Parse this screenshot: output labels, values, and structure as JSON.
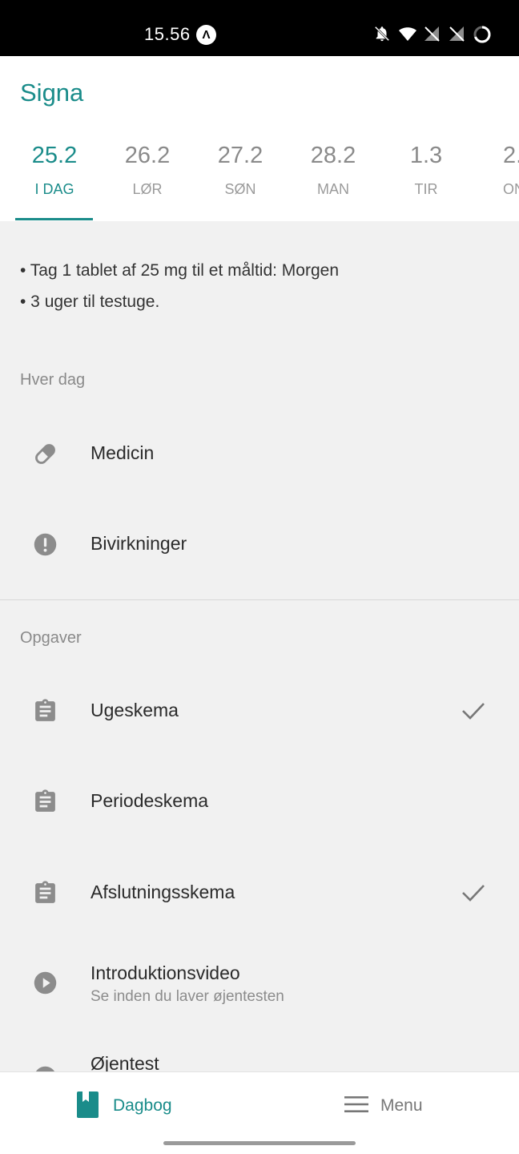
{
  "status_bar": {
    "time": "15.56",
    "icons": [
      "app-notification-icon",
      "bell-off-icon",
      "wifi-icon",
      "signal-no-sim-icon",
      "signal-no-sim-icon",
      "battery-ring-icon"
    ]
  },
  "app": {
    "title": "Signa",
    "accent_color": "#1a8c8a"
  },
  "tabs": [
    {
      "date": "25.2",
      "day": "I DAG",
      "active": true
    },
    {
      "date": "26.2",
      "day": "LØR"
    },
    {
      "date": "27.2",
      "day": "SØN"
    },
    {
      "date": "28.2",
      "day": "MAN"
    },
    {
      "date": "1.3",
      "day": "TIR"
    },
    {
      "date": "2.",
      "day": "ON"
    }
  ],
  "info": {
    "lines": [
      "• Tag 1 tablet af 25 mg til et måltid: Morgen",
      "• 3 uger til testuge."
    ]
  },
  "daily": {
    "heading": "Hver dag",
    "items": [
      {
        "label": "Medicin",
        "icon": "pill-icon"
      },
      {
        "label": "Bivirkninger",
        "icon": "alert-circle-icon"
      }
    ]
  },
  "tasks": {
    "heading": "Opgaver",
    "items": [
      {
        "label": "Ugeskema",
        "icon": "clipboard-icon",
        "done": true
      },
      {
        "label": "Periodeskema",
        "icon": "clipboard-icon",
        "done": false
      },
      {
        "label": "Afslutningsskema",
        "icon": "clipboard-icon",
        "done": true
      },
      {
        "label": "Introduktionsvideo",
        "subtitle": "Se inden du laver øjentesten",
        "icon": "play-circle-icon",
        "done": false
      },
      {
        "label": "Øjentest",
        "icon": "eye-icon",
        "done": false
      }
    ]
  },
  "bottom_nav": {
    "items": [
      {
        "label": "Dagbog",
        "icon": "diary-icon",
        "active": true
      },
      {
        "label": "Menu",
        "icon": "menu-icon",
        "active": false
      }
    ]
  }
}
